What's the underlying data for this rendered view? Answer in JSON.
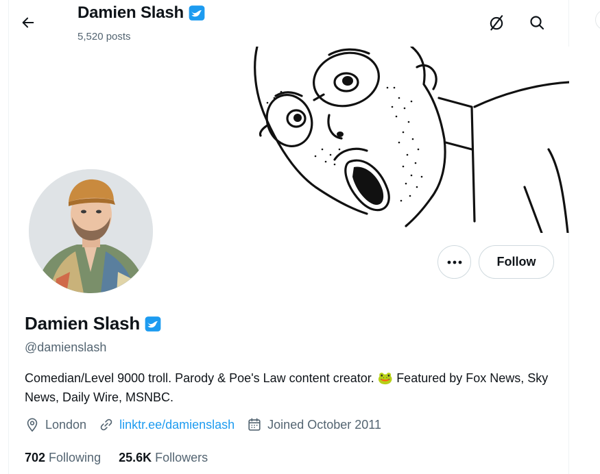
{
  "header": {
    "name": "Damien Slash",
    "posts_count": "5,520 posts"
  },
  "profile": {
    "name": "Damien Slash",
    "handle": "@damienslash",
    "bio_text": "Comedian/Level 9000 troll.  Parody & Poe's Law content creator.",
    "bio_emoji": "🐸",
    "bio_text_2": "Featured by Fox News, Sky News, Daily Wire, MSNBC.",
    "location": "London",
    "website": "linktr.ee/damienslash",
    "joined": "Joined October 2011",
    "following_count": "702",
    "following_label": "Following",
    "followers_count": "25.6K",
    "followers_label": "Followers"
  },
  "actions": {
    "follow_label": "Follow",
    "more_icon": "ellipsis-icon"
  },
  "icons": {
    "back": "back-arrow-icon",
    "no_connection": "no-signal-icon",
    "search": "search-icon",
    "verified": "verified-badge-icon",
    "location": "location-pin-icon",
    "link": "link-icon",
    "calendar": "calendar-icon"
  },
  "colors": {
    "accent": "#1d9bf0",
    "secondary_text": "#536471",
    "border": "#cfd9de"
  }
}
